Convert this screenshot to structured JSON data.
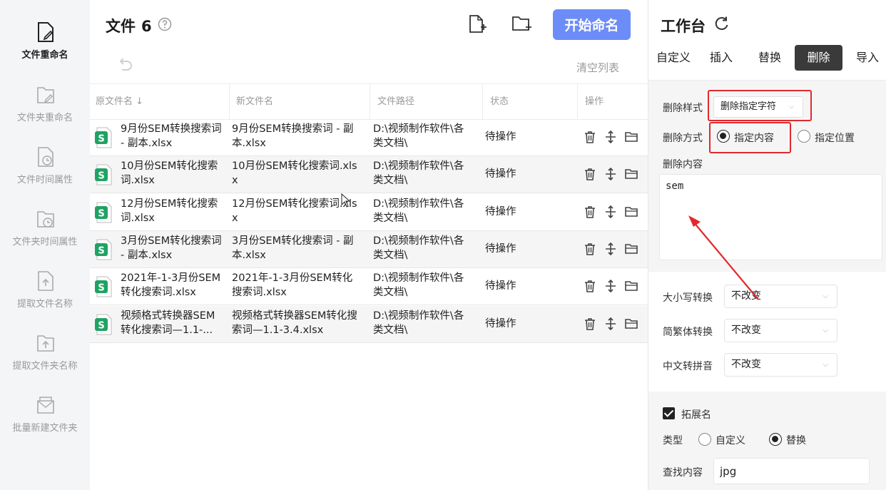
{
  "sidebar": {
    "items": [
      {
        "label": "文件重命名",
        "icon": "file-edit-icon",
        "active": true
      },
      {
        "label": "文件夹重命名",
        "icon": "folder-edit-icon"
      },
      {
        "label": "文件时间属性",
        "icon": "file-clock-icon"
      },
      {
        "label": "文件夹时间属性",
        "icon": "folder-clock-icon"
      },
      {
        "label": "提取文件名称",
        "icon": "file-upload-icon"
      },
      {
        "label": "提取文件夹名称",
        "icon": "folder-upload-icon"
      },
      {
        "label": "批量新建文件夹",
        "icon": "folder-new-icon"
      }
    ]
  },
  "header": {
    "title": "文件",
    "count": "6",
    "start_button": "开始命名",
    "clear_list": "清空列表",
    "icons": [
      "help-icon",
      "add-file-icon",
      "add-folder-icon",
      "undo-icon"
    ]
  },
  "table": {
    "columns": [
      "原文件名 ↓",
      "新文件名",
      "文件路径",
      "状态",
      "操作"
    ],
    "rows": [
      {
        "orig": "9月份SEM转换搜索词 - 副本.xlsx",
        "new": "9月份SEM转换搜索词 - 副本.xlsx",
        "path": "D:\\视频制作软件\\各类文档\\",
        "status": "待操作"
      },
      {
        "orig": "10月份SEM转化搜索词.xlsx",
        "new": "10月份SEM转化搜索词.xlsx",
        "path": "D:\\视频制作软件\\各类文档\\",
        "status": "待操作"
      },
      {
        "orig": "12月份SEM转化搜索词.xlsx",
        "new": "12月份SEM转化搜索词.xlsx",
        "path": "D:\\视频制作软件\\各类文档\\",
        "status": "待操作"
      },
      {
        "orig": "3月份SEM转化搜索词 - 副本.xlsx",
        "new": "3月份SEM转化搜索词 - 副本.xlsx",
        "path": "D:\\视频制作软件\\各类文档\\",
        "status": "待操作"
      },
      {
        "orig": "2021年-1-3月份SEM转化搜索词.xlsx",
        "new": "2021年-1-3月份SEM转化搜索词.xlsx",
        "path": "D:\\视频制作软件\\各类文档\\",
        "status": "待操作"
      },
      {
        "orig": "视频格式转换器SEM转化搜索词—1.1-...",
        "new": "视频格式转换器SEM转化搜索词—1.1-3.4.xlsx",
        "path": "D:\\视频制作软件\\各类文档\\",
        "status": "待操作"
      }
    ],
    "row_icons": [
      "trash-icon",
      "move-icon",
      "folder-open-icon"
    ]
  },
  "workbench": {
    "title": "工作台",
    "tabs": [
      "自定义",
      "插入",
      "替换",
      "删除",
      "导入"
    ],
    "active_tab": "删除",
    "delete_style_label": "删除样式",
    "delete_style_value": "删除指定字符",
    "delete_mode_label": "删除方式",
    "mode_options": [
      "指定内容",
      "指定位置"
    ],
    "selected_mode": "指定内容",
    "delete_content_label": "删除内容",
    "delete_content_value": "sem",
    "case_label": "大小写转换",
    "case_value": "不改变",
    "trad_label": "简繁体转换",
    "trad_value": "不改变",
    "pinyin_label": "中文转拼音",
    "pinyin_value": "不改变",
    "ext_label": "拓展名",
    "ext_checked": true,
    "type_label": "类型",
    "type_options": [
      "自定义",
      "替换"
    ],
    "selected_type": "替换",
    "find_label": "查找内容",
    "find_value": "jpg"
  },
  "colors": {
    "accent": "#6c8cf7",
    "annotation_red": "#e2282c",
    "excel_green": "#1fa363",
    "active_tab": "#3a3a3a"
  }
}
